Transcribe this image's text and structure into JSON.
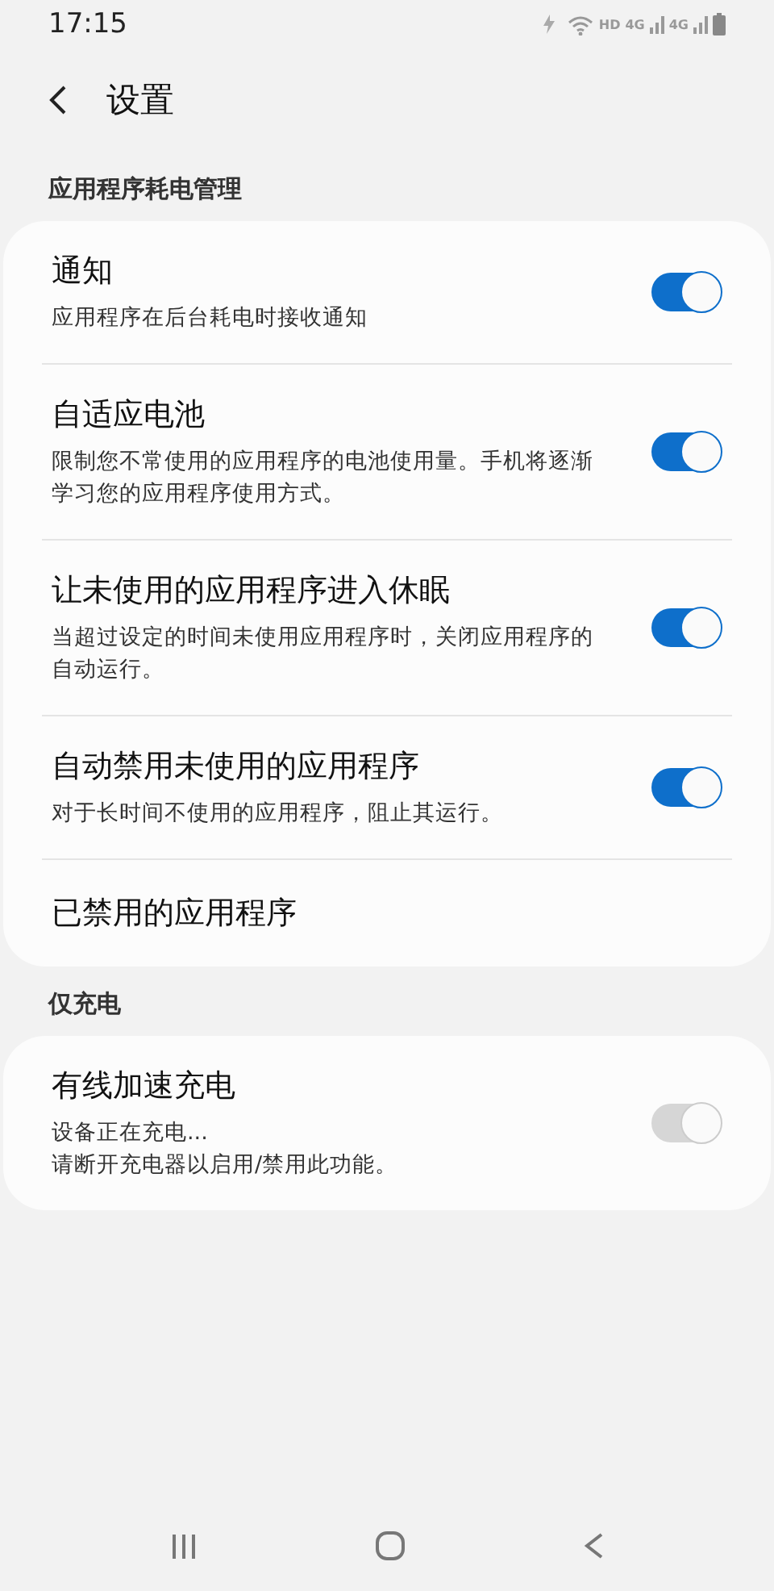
{
  "status_bar": {
    "time": "17:15",
    "network_labels": [
      "HD",
      "4G",
      "4G"
    ]
  },
  "header": {
    "title": "设置"
  },
  "sections": [
    {
      "title": "应用程序耗电管理",
      "items": [
        {
          "kind": "toggle",
          "title": "通知",
          "description": "应用程序在后台耗电时接收通知",
          "on": true,
          "disabled": false
        },
        {
          "kind": "toggle",
          "title": "自适应电池",
          "description": "限制您不常使用的应用程序的电池使用量。手机将逐渐学习您的应用程序使用方式。",
          "on": true,
          "disabled": false
        },
        {
          "kind": "toggle",
          "title": "让未使用的应用程序进入休眠",
          "description": "当超过设定的时间未使用应用程序时，关闭应用程序的自动运行。",
          "on": true,
          "disabled": false
        },
        {
          "kind": "toggle",
          "title": "自动禁用未使用的应用程序",
          "description": "对于长时间不使用的应用程序，阻止其运行。",
          "on": true,
          "disabled": false
        },
        {
          "kind": "link",
          "title": "已禁用的应用程序"
        }
      ]
    },
    {
      "title": "仅充电",
      "items": [
        {
          "kind": "toggle",
          "title": "有线加速充电",
          "description": "设备正在充电...\n请断开充电器以启用/禁用此功能。",
          "on": true,
          "disabled": true
        }
      ]
    }
  ]
}
